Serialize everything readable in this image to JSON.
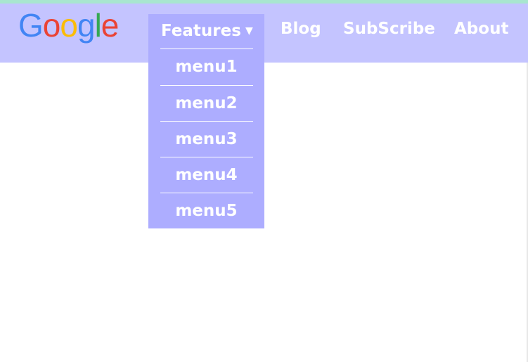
{
  "logo": {
    "letters": [
      {
        "char": "G",
        "color": "#4285F4"
      },
      {
        "char": "o",
        "color": "#EA4335"
      },
      {
        "char": "o",
        "color": "#FBBC05"
      },
      {
        "char": "g",
        "color": "#4285F4"
      },
      {
        "char": "l",
        "color": "#34A853"
      },
      {
        "char": "e",
        "color": "#EA4335"
      }
    ]
  },
  "nav": {
    "features_label": "Features",
    "features_caret": "▼",
    "blog_label": "Blog",
    "subscribe_label": "SubScribe",
    "about_label": "About"
  },
  "dropdown": {
    "items": [
      "menu1",
      "menu2",
      "menu3",
      "menu4",
      "menu5"
    ]
  },
  "colors": {
    "navbar_bg": "#c4c4ff",
    "dropdown_bg": "#adadff",
    "top_strip": "#a8e6cf",
    "text": "#ffffff"
  }
}
